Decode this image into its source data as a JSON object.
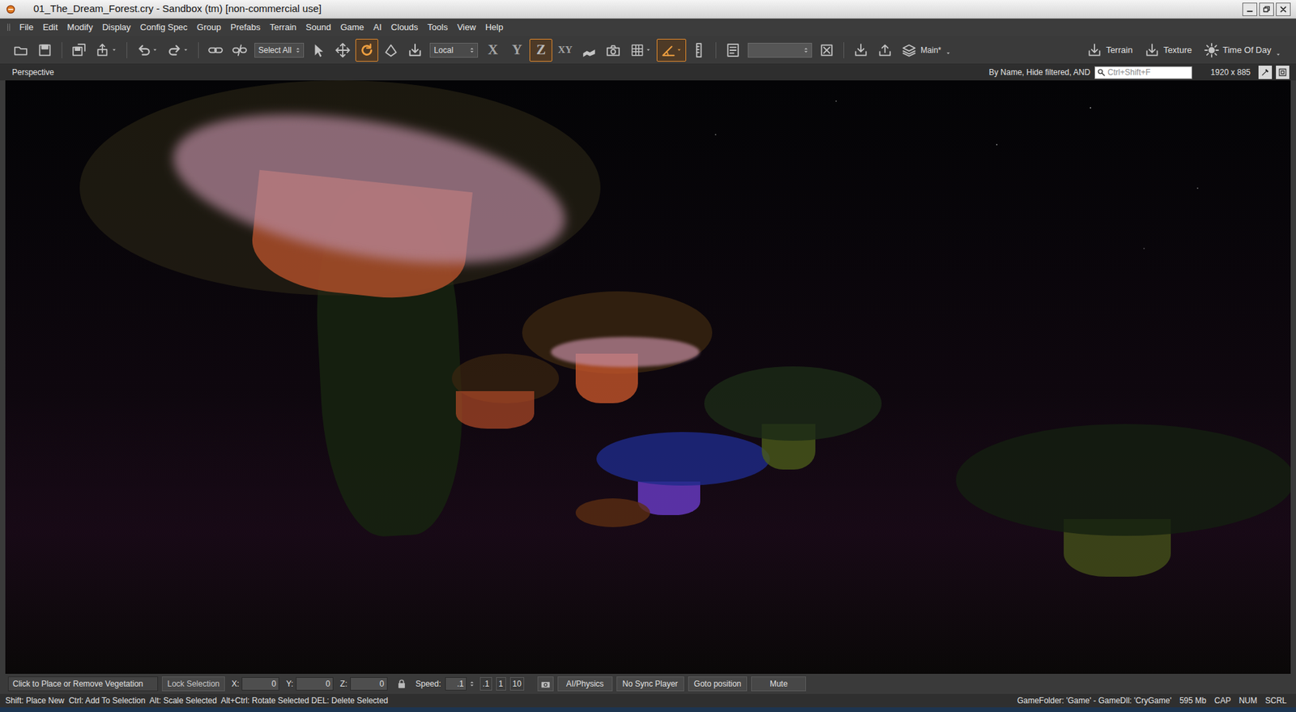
{
  "window": {
    "title": "01_The_Dream_Forest.cry - Sandbox (tm) [non-commercial use]"
  },
  "menu": [
    "File",
    "Edit",
    "Modify",
    "Display",
    "Config Spec",
    "Group",
    "Prefabs",
    "Terrain",
    "Sound",
    "Game",
    "AI",
    "Clouds",
    "Tools",
    "View",
    "Help"
  ],
  "toolbar": [
    {
      "kind": "icon",
      "selected": false
    },
    {
      "kind": "icon",
      "selected": false
    },
    {
      "kind": "sep"
    },
    {
      "kind": "icon",
      "selected": false
    },
    {
      "kind": "iconmenu",
      "selected": false
    },
    {
      "kind": "sep"
    },
    {
      "kind": "iconmenu",
      "selected": false
    },
    {
      "kind": "iconmenu",
      "selected": false
    },
    {
      "kind": "sep"
    },
    {
      "kind": "icon",
      "selected": false
    },
    {
      "kind": "icon",
      "selected": false
    },
    {
      "kind": "dropdown",
      "value": "Select All"
    },
    {
      "kind": "icon",
      "selected": false
    },
    {
      "kind": "icon",
      "selected": false
    },
    {
      "kind": "icon",
      "selected": true
    },
    {
      "kind": "icon",
      "selected": false
    },
    {
      "kind": "icon",
      "selected": false
    },
    {
      "kind": "dropdown",
      "value": "Local"
    },
    {
      "kind": "axis",
      "label": "X",
      "selected": false
    },
    {
      "kind": "axis",
      "label": "Y",
      "selected": false
    },
    {
      "kind": "axis",
      "label": "Z",
      "selected": true
    },
    {
      "kind": "axis",
      "label": "XY",
      "selected": false
    },
    {
      "kind": "icon",
      "selected": false
    },
    {
      "kind": "icon",
      "selected": false
    },
    {
      "kind": "iconmenu",
      "selected": false
    },
    {
      "kind": "iconmenu",
      "selected": true
    },
    {
      "kind": "icon",
      "selected": false
    },
    {
      "kind": "sep"
    },
    {
      "kind": "icon",
      "selected": false
    },
    {
      "kind": "combo"
    },
    {
      "kind": "icon",
      "selected": false
    },
    {
      "kind": "sep"
    },
    {
      "kind": "icon",
      "selected": false
    },
    {
      "kind": "icon",
      "selected": false
    },
    {
      "kind": "layer",
      "label": "Main*"
    }
  ],
  "toolbar_right": [
    {
      "label": "Terrain"
    },
    {
      "label": "Texture"
    },
    {
      "label": "Time Of Day"
    }
  ],
  "viewport": {
    "label": "Perspective",
    "filter": "By Name, Hide filtered, AND",
    "search_placeholder": "Ctrl+Shift+F",
    "resolution": "1920 x 885"
  },
  "bottom_bar": {
    "prompt": "Click to Place or Remove Vegetation",
    "lock_button": "Lock Selection",
    "coords": [
      {
        "axis": "X:",
        "value": "0"
      },
      {
        "axis": "Y:",
        "value": "0"
      },
      {
        "axis": "Z:",
        "value": "0"
      }
    ],
    "speed_label": "Speed:",
    "speed_value": ".1",
    "speed_presets": [
      ".1",
      "1",
      "10"
    ],
    "buttons": [
      "AI/Physics",
      "No Sync Player",
      "Goto position",
      "Mute"
    ]
  },
  "status_bar": {
    "hints": "Shift: Place New  Ctrl: Add To Selection  Alt: Scale Selected  Alt+Ctrl: Rotate Selected DEL: Delete Selected",
    "game": "GameFolder: 'Game' - GameDll: 'CryGame'",
    "memory": "595 Mb",
    "keys": [
      "CAP",
      "NUM",
      "SCRL"
    ]
  }
}
